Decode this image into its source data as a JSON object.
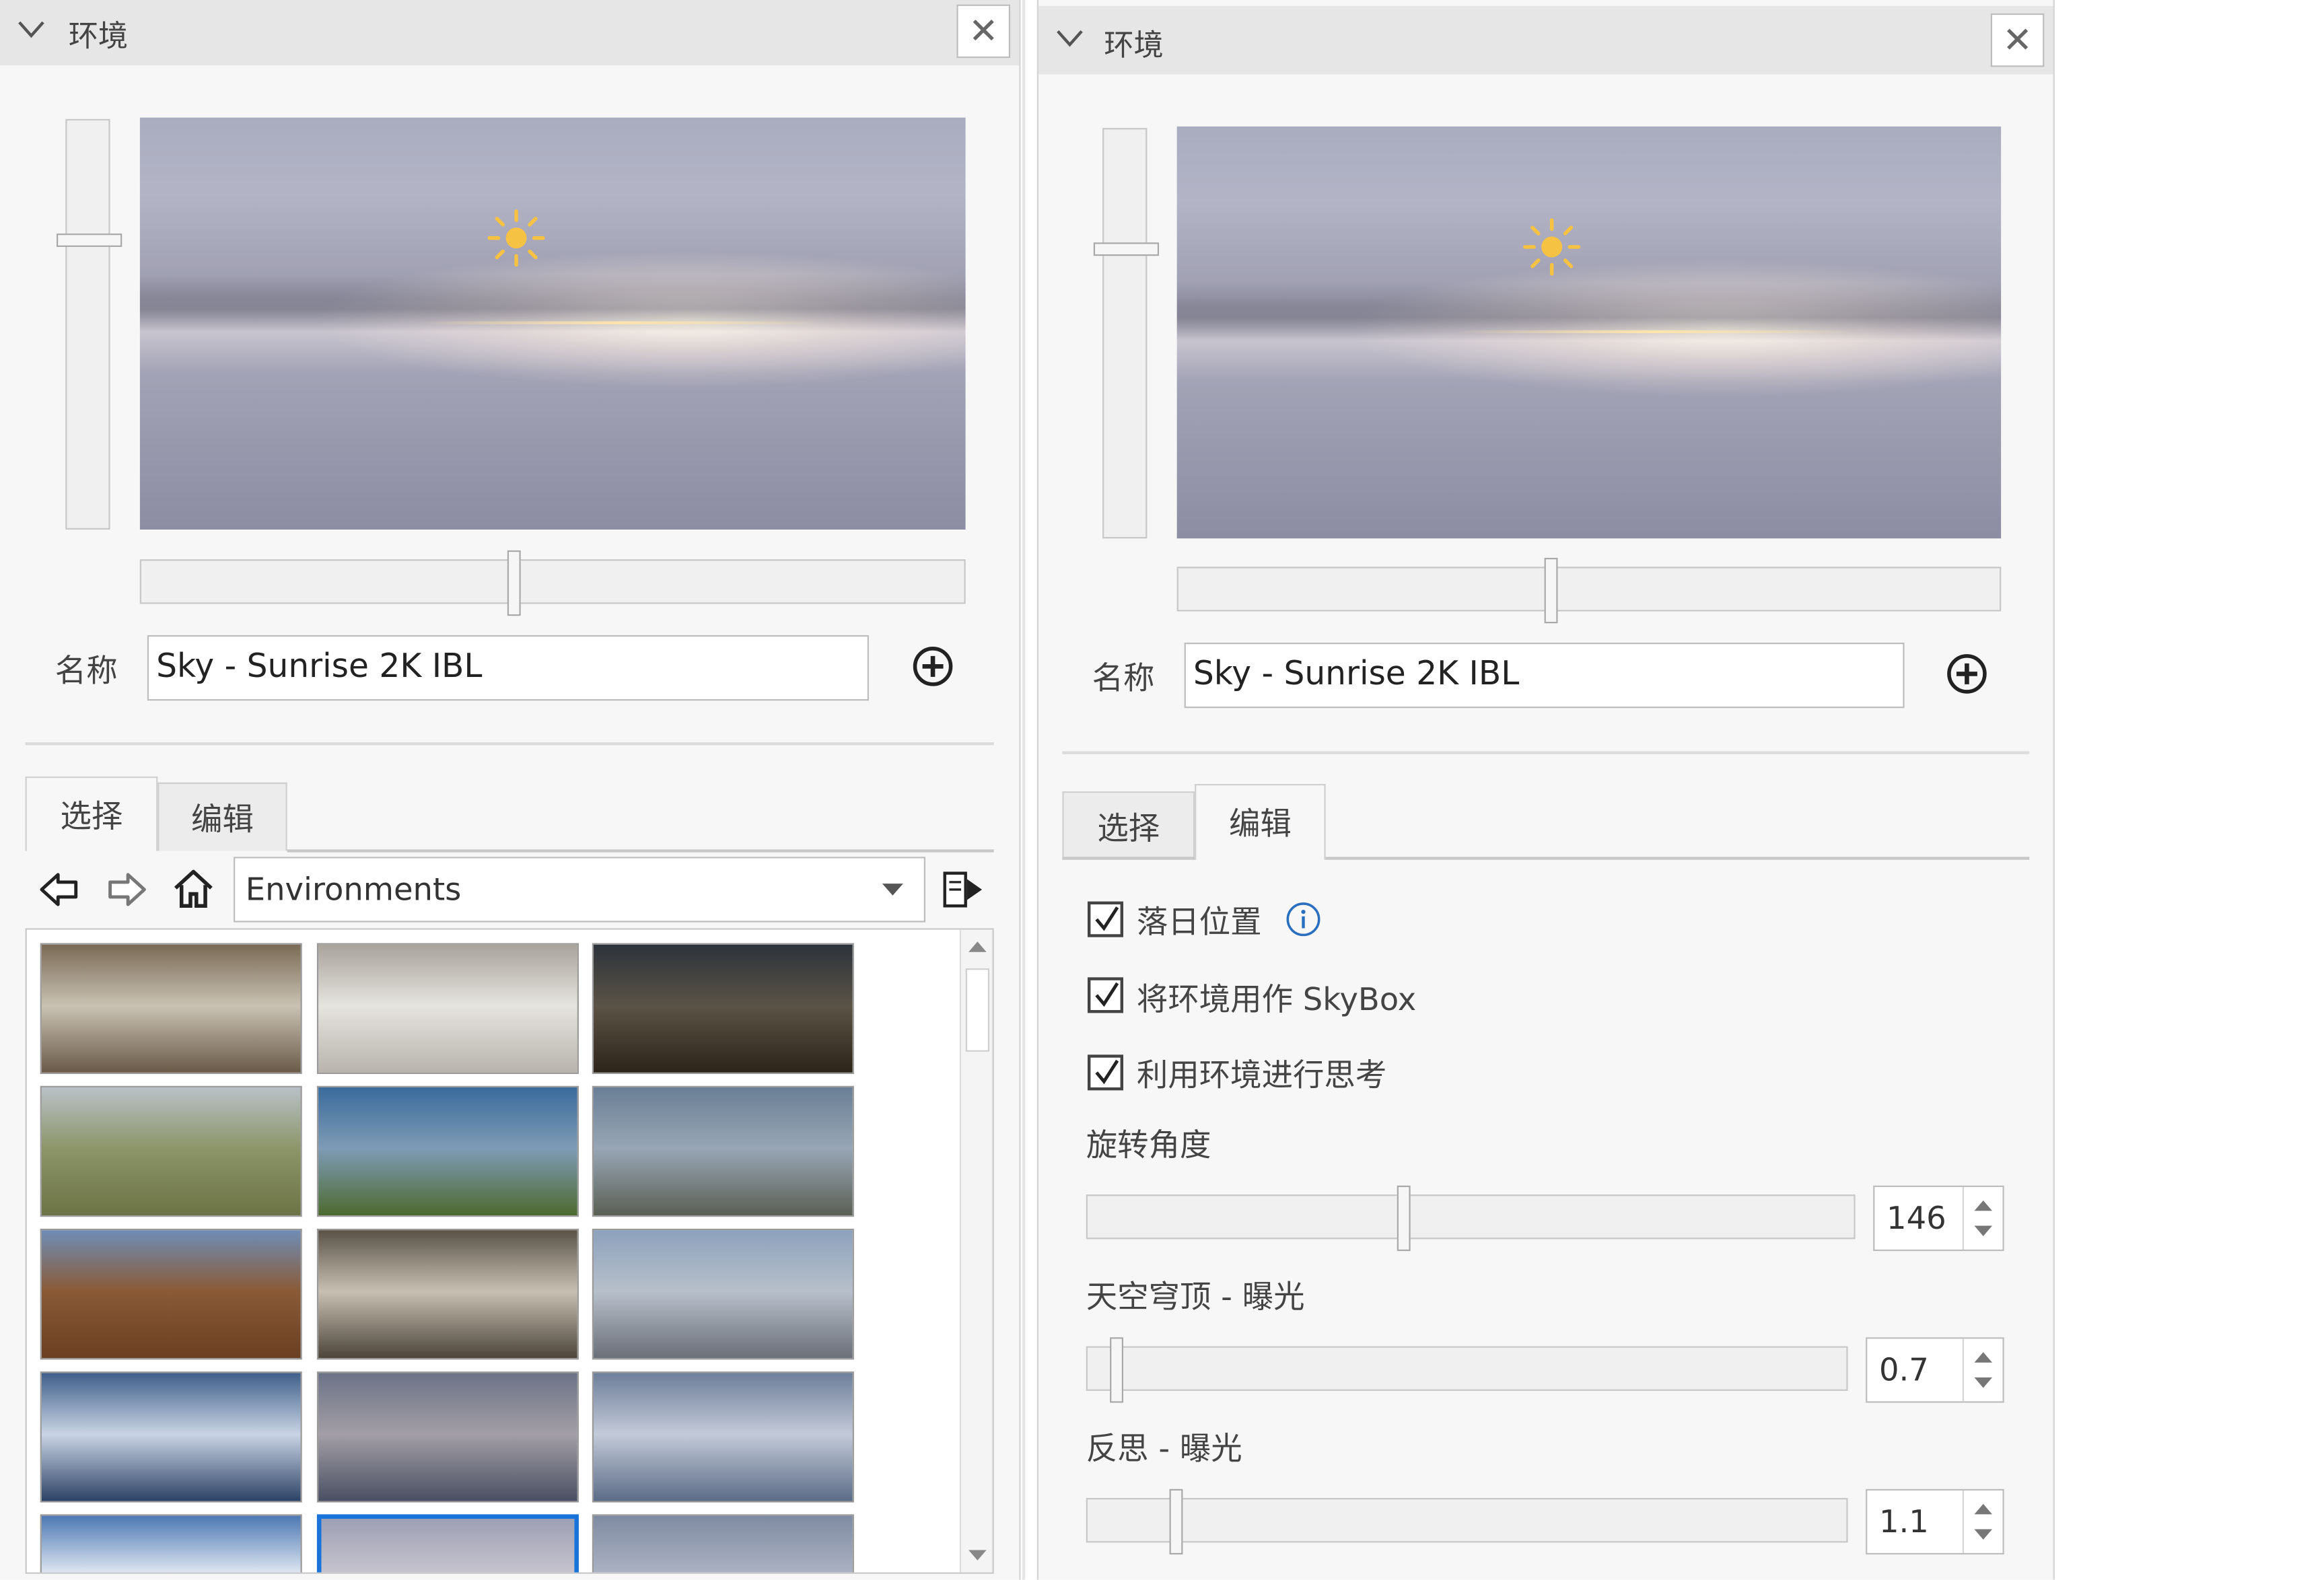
{
  "left_panel": {
    "title": "环境",
    "close_label": "✕",
    "name_label": "名称",
    "name_value": "Sky - Sunrise 2K IBL",
    "tabs": [
      {
        "label": "选择",
        "active": true
      },
      {
        "label": "编辑",
        "active": false
      }
    ],
    "browser": {
      "location": "Environments",
      "thumbnails": [
        {
          "name": "warehouse-interior-1",
          "colors": [
            "#7a6a55",
            "#c9c2b3",
            "#6a5a48"
          ]
        },
        {
          "name": "warehouse-interior-2",
          "colors": [
            "#a8a39b",
            "#e6e4df",
            "#b8b4ad"
          ]
        },
        {
          "name": "dusk-field",
          "colors": [
            "#2d333b",
            "#5a5346",
            "#2c2418"
          ]
        },
        {
          "name": "green-field-trees",
          "colors": [
            "#b9c1c7",
            "#8c9568",
            "#6c7446"
          ]
        },
        {
          "name": "blue-sky-meadow",
          "colors": [
            "#3a6b9c",
            "#7e9bb5",
            "#4d6a30"
          ]
        },
        {
          "name": "city-panorama-cloudy",
          "colors": [
            "#6a7f96",
            "#98a6b5",
            "#5b6055"
          ]
        },
        {
          "name": "autumn-forest",
          "colors": [
            "#6f8db5",
            "#8a5a36",
            "#6b3f22"
          ]
        },
        {
          "name": "empty-hall",
          "colors": [
            "#5a5247",
            "#c7c0b2",
            "#4d453a"
          ]
        },
        {
          "name": "rooftop-snow",
          "colors": [
            "#8da2bd",
            "#b7bfca",
            "#6a6f78"
          ]
        },
        {
          "name": "sky-blue-horizon",
          "colors": [
            "#3f5f8a",
            "#c9d4e4",
            "#2d4266"
          ]
        },
        {
          "name": "sky-overcast-pink",
          "colors": [
            "#6c7387",
            "#a39ea6",
            "#4a5063"
          ]
        },
        {
          "name": "sky-overcast-blue",
          "colors": [
            "#6e7f9b",
            "#c3cad8",
            "#5b6b87"
          ]
        },
        {
          "name": "sky-clouds-blue",
          "colors": [
            "#4c78b3",
            "#e9eef5",
            "#5f8bc2"
          ]
        },
        {
          "name": "sky-sunrise-selected",
          "colors": [
            "#9d9fb3",
            "#c9c6d0",
            "#a3a4b5"
          ]
        },
        {
          "name": "sky-grey",
          "colors": [
            "#7f8ba2",
            "#aeb5c5",
            "#737f96"
          ]
        }
      ]
    }
  },
  "right_panel": {
    "title": "环境",
    "close_label": "✕",
    "name_label": "名称",
    "name_value": "Sky - Sunrise 2K IBL",
    "tabs": [
      {
        "label": "选择",
        "active": false
      },
      {
        "label": "编辑",
        "active": true
      }
    ],
    "checkboxes": [
      {
        "label": "落日位置",
        "checked": true
      },
      {
        "label": "将环境用作 SkyBox",
        "checked": true
      },
      {
        "label": "利用环境进行思考",
        "checked": true
      }
    ],
    "sliders": [
      {
        "label": "旋转角度",
        "value": "146",
        "level": 0.41
      },
      {
        "label": "天空穹顶 - 曝光",
        "value": "0.7",
        "level": 0.03
      },
      {
        "label": "反思 - 曝光",
        "value": "1.1",
        "level": 0.11
      }
    ]
  },
  "colors": {
    "selection_blue": "#1a73d9",
    "sun_yellow": "#f6c243"
  }
}
